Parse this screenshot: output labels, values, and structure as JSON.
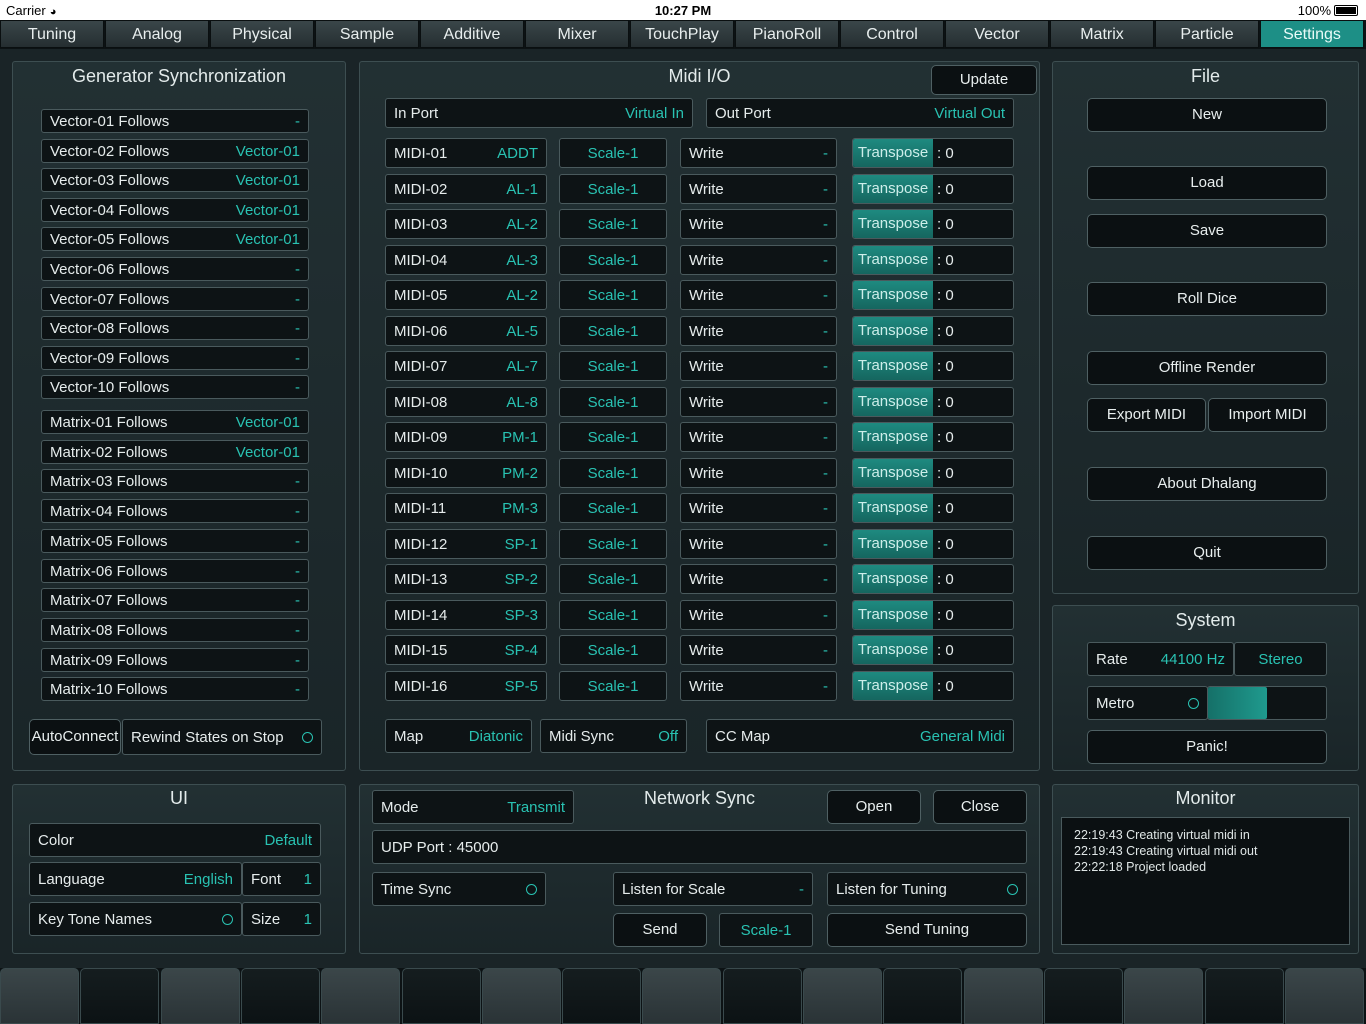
{
  "status": {
    "carrier": "Carrier",
    "time": "10:27 PM",
    "battery": "100%"
  },
  "tabs": [
    "Tuning",
    "Analog",
    "Physical",
    "Sample",
    "Additive",
    "Mixer",
    "TouchPlay",
    "PianoRoll",
    "Control",
    "Vector",
    "Matrix",
    "Particle",
    "Settings"
  ],
  "active_tab": "Settings",
  "colors": {
    "accent": "#29c2b2",
    "active_tab": "#1d8f86",
    "background": "#1a2427"
  },
  "gensync": {
    "title": "Generator Synchronization",
    "vectors": [
      {
        "label": "Vector-01 Follows",
        "value": "-"
      },
      {
        "label": "Vector-02 Follows",
        "value": "Vector-01"
      },
      {
        "label": "Vector-03 Follows",
        "value": "Vector-01"
      },
      {
        "label": "Vector-04 Follows",
        "value": "Vector-01"
      },
      {
        "label": "Vector-05 Follows",
        "value": "Vector-01"
      },
      {
        "label": "Vector-06 Follows",
        "value": "-"
      },
      {
        "label": "Vector-07 Follows",
        "value": "-"
      },
      {
        "label": "Vector-08 Follows",
        "value": "-"
      },
      {
        "label": "Vector-09 Follows",
        "value": "-"
      },
      {
        "label": "Vector-10 Follows",
        "value": "-"
      }
    ],
    "matrices": [
      {
        "label": "Matrix-01 Follows",
        "value": "Vector-01"
      },
      {
        "label": "Matrix-02 Follows",
        "value": "Vector-01"
      },
      {
        "label": "Matrix-03 Follows",
        "value": "-"
      },
      {
        "label": "Matrix-04 Follows",
        "value": "-"
      },
      {
        "label": "Matrix-05 Follows",
        "value": "-"
      },
      {
        "label": "Matrix-06 Follows",
        "value": "-"
      },
      {
        "label": "Matrix-07 Follows",
        "value": "-"
      },
      {
        "label": "Matrix-08 Follows",
        "value": "-"
      },
      {
        "label": "Matrix-09 Follows",
        "value": "-"
      },
      {
        "label": "Matrix-10 Follows",
        "value": "-"
      }
    ],
    "autoconnect": "AutoConnect",
    "rewind": "Rewind States on Stop"
  },
  "midi": {
    "title": "Midi I/O",
    "update": "Update",
    "in_port": {
      "label": "In Port",
      "value": "Virtual In"
    },
    "out_port": {
      "label": "Out Port",
      "value": "Virtual Out"
    },
    "rows": [
      {
        "name": "MIDI-01",
        "target": "ADDT",
        "scale": "Scale-1",
        "mode": "Write",
        "mode_val": "-",
        "transpose": "Transpose",
        "tval": ": 0"
      },
      {
        "name": "MIDI-02",
        "target": "AL-1",
        "scale": "Scale-1",
        "mode": "Write",
        "mode_val": "-",
        "transpose": "Transpose",
        "tval": ": 0"
      },
      {
        "name": "MIDI-03",
        "target": "AL-2",
        "scale": "Scale-1",
        "mode": "Write",
        "mode_val": "-",
        "transpose": "Transpose",
        "tval": ": 0"
      },
      {
        "name": "MIDI-04",
        "target": "AL-3",
        "scale": "Scale-1",
        "mode": "Write",
        "mode_val": "-",
        "transpose": "Transpose",
        "tval": ": 0"
      },
      {
        "name": "MIDI-05",
        "target": "AL-2",
        "scale": "Scale-1",
        "mode": "Write",
        "mode_val": "-",
        "transpose": "Transpose",
        "tval": ": 0"
      },
      {
        "name": "MIDI-06",
        "target": "AL-5",
        "scale": "Scale-1",
        "mode": "Write",
        "mode_val": "-",
        "transpose": "Transpose",
        "tval": ": 0"
      },
      {
        "name": "MIDI-07",
        "target": "AL-7",
        "scale": "Scale-1",
        "mode": "Write",
        "mode_val": "-",
        "transpose": "Transpose",
        "tval": ": 0"
      },
      {
        "name": "MIDI-08",
        "target": "AL-8",
        "scale": "Scale-1",
        "mode": "Write",
        "mode_val": "-",
        "transpose": "Transpose",
        "tval": ": 0"
      },
      {
        "name": "MIDI-09",
        "target": "PM-1",
        "scale": "Scale-1",
        "mode": "Write",
        "mode_val": "-",
        "transpose": "Transpose",
        "tval": ": 0"
      },
      {
        "name": "MIDI-10",
        "target": "PM-2",
        "scale": "Scale-1",
        "mode": "Write",
        "mode_val": "-",
        "transpose": "Transpose",
        "tval": ": 0"
      },
      {
        "name": "MIDI-11",
        "target": "PM-3",
        "scale": "Scale-1",
        "mode": "Write",
        "mode_val": "-",
        "transpose": "Transpose",
        "tval": ": 0"
      },
      {
        "name": "MIDI-12",
        "target": "SP-1",
        "scale": "Scale-1",
        "mode": "Write",
        "mode_val": "-",
        "transpose": "Transpose",
        "tval": ": 0"
      },
      {
        "name": "MIDI-13",
        "target": "SP-2",
        "scale": "Scale-1",
        "mode": "Write",
        "mode_val": "-",
        "transpose": "Transpose",
        "tval": ": 0"
      },
      {
        "name": "MIDI-14",
        "target": "SP-3",
        "scale": "Scale-1",
        "mode": "Write",
        "mode_val": "-",
        "transpose": "Transpose",
        "tval": ": 0"
      },
      {
        "name": "MIDI-15",
        "target": "SP-4",
        "scale": "Scale-1",
        "mode": "Write",
        "mode_val": "-",
        "transpose": "Transpose",
        "tval": ": 0"
      },
      {
        "name": "MIDI-16",
        "target": "SP-5",
        "scale": "Scale-1",
        "mode": "Write",
        "mode_val": "-",
        "transpose": "Transpose",
        "tval": ": 0"
      }
    ],
    "map": {
      "label": "Map",
      "value": "Diatonic"
    },
    "midisync": {
      "label": "Midi Sync",
      "value": "Off"
    },
    "ccmap": {
      "label": "CC Map",
      "value": "General Midi"
    }
  },
  "file": {
    "title": "File",
    "new": "New",
    "load": "Load",
    "save": "Save",
    "roll_dice": "Roll Dice",
    "offline_render": "Offline Render",
    "export_midi": "Export MIDI",
    "import_midi": "Import MIDI",
    "about": "About Dhalang",
    "quit": "Quit"
  },
  "system": {
    "title": "System",
    "rate_label": "Rate",
    "rate_value": "44100 Hz",
    "stereo": "Stereo",
    "metro": "Metro",
    "metro_level": 0.5,
    "panic": "Panic!"
  },
  "ui": {
    "title": "UI",
    "color": {
      "label": "Color",
      "value": "Default"
    },
    "language": {
      "label": "Language",
      "value": "English"
    },
    "font": {
      "label": "Font",
      "value": "1"
    },
    "keytone": {
      "label": "Key Tone Names"
    },
    "size": {
      "label": "Size",
      "value": "1"
    }
  },
  "network": {
    "title": "Network Sync",
    "mode": {
      "label": "Mode",
      "value": "Transmit"
    },
    "open": "Open",
    "close": "Close",
    "udp": "UDP Port : 45000",
    "timesync": "Time Sync",
    "listen_scale": {
      "label": "Listen for Scale",
      "value": "-"
    },
    "listen_tuning": "Listen for Tuning",
    "send": "Send",
    "scale": "Scale-1",
    "send_tuning": "Send Tuning"
  },
  "monitor": {
    "title": "Monitor",
    "lines": [
      "22:19:43 Creating virtual midi in",
      "22:19:43 Creating virtual midi out",
      "22:22:18 Project loaded"
    ]
  }
}
